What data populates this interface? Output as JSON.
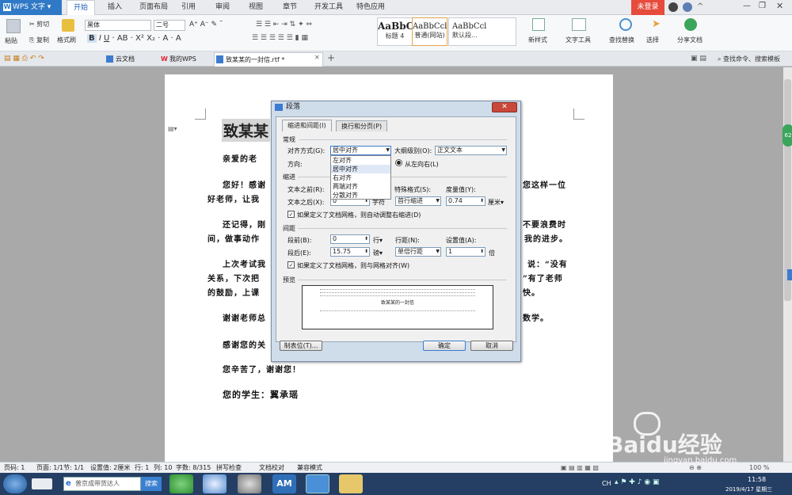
{
  "app": {
    "name": "WPS 文字",
    "login": "未登录"
  },
  "menus": [
    "开始",
    "插入",
    "页面布局",
    "引用",
    "审阅",
    "视图",
    "章节",
    "开发工具",
    "特色应用"
  ],
  "ribbon": {
    "paste": "粘贴",
    "cut": "剪切",
    "copy": "复制",
    "format_painter": "格式刷",
    "font": "黑体",
    "size": "二号",
    "styles": [
      {
        "sample": "AaBbC",
        "name": "标题 4"
      },
      {
        "sample": "AaBbCcl",
        "name": "普通(网站)"
      },
      {
        "sample": "AaBbCcl",
        "name": "默认段..."
      }
    ],
    "new_style": "新样式",
    "text_tool": "文字工具",
    "find_replace": "查找替换",
    "select": "选择",
    "share": "分享文档"
  },
  "tabs": [
    "云文档",
    "我的WPS",
    "致某某的一封信.rtf *"
  ],
  "search_cmd": "查找命令、搜索模板",
  "document": {
    "title": "致某某",
    "lines": [
      "亲爱的老",
      "您好！感谢",
      "好老师，让我",
      "还记得，刚",
      "间，做事动作",
      "上次考试我",
      "关系，下次把",
      "的鼓励，上课",
      "谢谢老师总",
      "感谢您的关",
      "您辛苦了，谢谢您！",
      "您的学生：翼承瑶"
    ],
    "right_lines": [
      "您这样一位",
      "不要浪费时",
      "我的进步。",
      "说：“没有",
      "”有了老师",
      "快。",
      "数学。"
    ]
  },
  "dialog": {
    "title": "段落",
    "tab_active": "缩进和间距(I)",
    "tab_other": "换行和分页(P)",
    "general": "常规",
    "align_label": "对齐方式(G):",
    "align_value": "居中对齐",
    "outline_label": "大纲级别(O):",
    "outline_value": "正文文本",
    "direction_label": "方向:",
    "ltr": "从左向右(L)",
    "align_options": [
      "左对齐",
      "居中对齐",
      "右对齐",
      "两端对齐",
      "分散对齐"
    ],
    "indent": "缩进",
    "before_text": "文本之前(R):",
    "after_text": "文本之后(X):",
    "after_value": "0",
    "unit_char": "字符",
    "special_label": "特殊格式(S):",
    "special_value": "首行缩进",
    "measure_label": "度量值(Y):",
    "measure_value": "0.74",
    "measure_unit": "厘米",
    "grid_indent": "如果定义了文档网格，则自动调整右缩进(D)",
    "spacing": "间距",
    "space_before": "段前(B):",
    "space_before_value": "0",
    "unit_line": "行",
    "space_after": "段后(E):",
    "space_after_value": "15.75",
    "unit_pt": "磅",
    "line_spacing_label": "行距(N):",
    "line_spacing_value": "单倍行距",
    "setting_label": "设置值(A):",
    "setting_value": "1",
    "unit_times": "倍",
    "grid_align": "如果定义了文档网格，则与网格对齐(W)",
    "preview": "预览",
    "preview_text": "致某某的一封信",
    "tabs_btn": "制表位(T)...",
    "ok": "确定",
    "cancel": "取消"
  },
  "status": {
    "page": "页码: 1",
    "pages": "页面: 1/1",
    "section": "节: 1/1",
    "setting": "设置值: 2厘米",
    "row": "行: 1",
    "col": "列: 10",
    "words": "字数: 8/315",
    "spell": "拼写检查",
    "proof": "文档校对",
    "compat": "兼容模式",
    "zoom": "100 %"
  },
  "taskbar": {
    "search": "普京成带货达人",
    "search_btn": "搜索",
    "time": "11:58",
    "date": "2019/4/17 星期三",
    "lang": "CH"
  },
  "watermark": {
    "brand": "Baidu经验",
    "url": "jingyan.baidu.com"
  },
  "colors": {
    "accent": "#2f79c6",
    "login": "#e64b3c",
    "taskbar": "#253e64"
  }
}
